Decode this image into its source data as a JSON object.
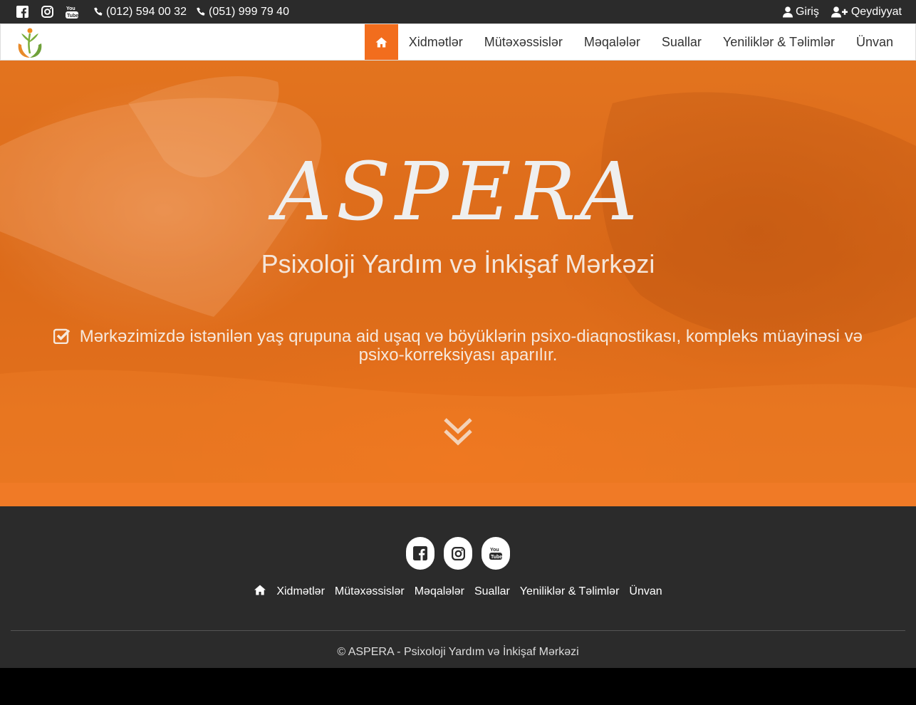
{
  "topbar": {
    "social_icons": [
      "facebook-icon",
      "instagram-icon",
      "youtube-icon"
    ],
    "phones": [
      "(012) 594 00 32",
      "(051) 999 79 40"
    ],
    "login_label": "Giriş",
    "register_label": "Qeydiyyat"
  },
  "navbar": {
    "home_icon": "home-icon",
    "items": [
      "Xidmətlər",
      "Mütəxəssislər",
      "Məqalələr",
      "Suallar",
      "Yeniliklər & Təlimlər",
      "Ünvan"
    ],
    "accent_color": "#f26d1d"
  },
  "hero": {
    "brand": "ASPERA",
    "tagline": "Psixoloji Yardım və İnkişaf Mərkəzi",
    "description": "Mərkəzimizdə istənilən yaş qrupuna aid uşaq və böyüklərin psixo-diaqnostikası, kompleks müayinəsi və psixo-korreksiyası aparılır.",
    "scroll_icon": "double-chevron-down-icon"
  },
  "footer": {
    "social_icons": [
      "facebook-icon",
      "instagram-icon",
      "youtube-icon"
    ],
    "menu": [
      "Xidmətlər",
      "Mütəxəssislər",
      "Məqalələr",
      "Suallar",
      "Yeniliklər & Təlimlər",
      "Ünvan"
    ],
    "copyright": "© ASPERA - Psixoloji Yardım və İnkişaf Mərkəzi"
  }
}
